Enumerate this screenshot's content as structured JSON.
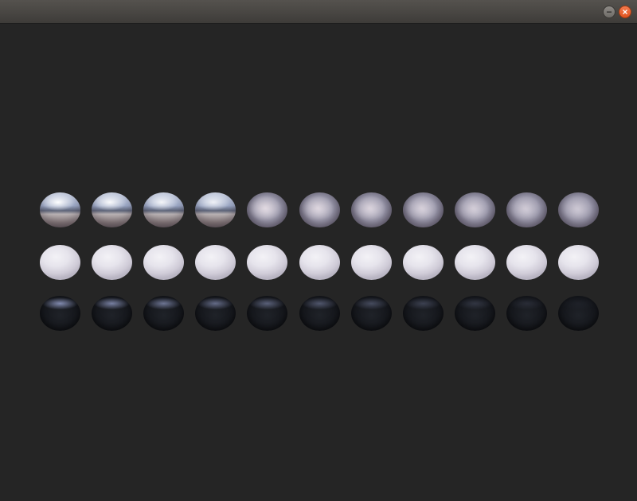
{
  "window": {
    "title": "",
    "minimize_icon": "minimize-icon",
    "close_icon": "close-icon",
    "close_color": "#e95420",
    "background": "#252525"
  },
  "scene": {
    "rows": [
      {
        "material": "metallic",
        "count": 11
      },
      {
        "material": "white-dielectric",
        "count": 11
      },
      {
        "material": "black-dielectric",
        "count": 11
      }
    ]
  }
}
